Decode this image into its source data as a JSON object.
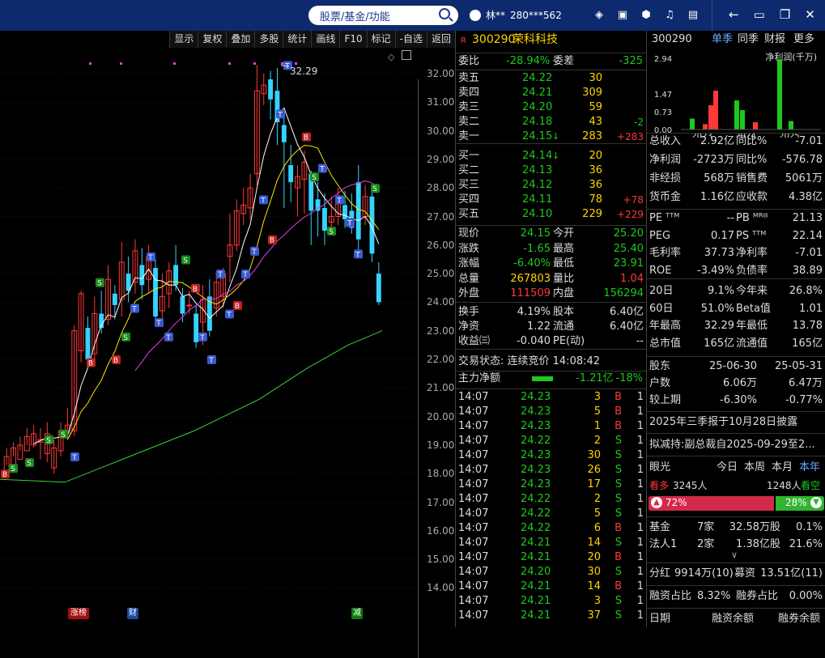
{
  "topbar": {
    "search_placeholder": "股票/基金/功能",
    "user_name": "林**",
    "user_id": "280***562",
    "window_controls": [
      "←",
      "❐",
      "✕"
    ]
  },
  "chart_menu": [
    "显示",
    "复权",
    "叠加",
    "多股",
    "统计",
    "画线",
    "F10",
    "标记",
    "-自选",
    "返回"
  ],
  "chart_price_scale": [
    "32.00",
    "31.00",
    "30.00",
    "29.00",
    "28.00",
    "27.00",
    "26.00",
    "25.00",
    "24.00",
    "23.00",
    "22.00",
    "21.00",
    "20.00",
    "19.00",
    "18.00",
    "17.00",
    "16.00",
    "15.00",
    "14.00"
  ],
  "chart_max_label": "32.29",
  "chart_bottom_tags": [
    "涨榜",
    "财",
    "减"
  ],
  "header": {
    "code": "300290",
    "name": "荣科科技",
    "badge": "R"
  },
  "weibi": {
    "label": "委比",
    "value": "-28.94%",
    "label2": "委差",
    "value2": "-325"
  },
  "asks": [
    {
      "label": "卖五",
      "price": "24.22",
      "vol": "30",
      "chg": ""
    },
    {
      "label": "卖四",
      "price": "24.21",
      "vol": "309",
      "chg": ""
    },
    {
      "label": "卖三",
      "price": "24.20",
      "vol": "59",
      "chg": ""
    },
    {
      "label": "卖二",
      "price": "24.18",
      "vol": "43",
      "chg": "-2"
    },
    {
      "label": "卖一",
      "price": "24.15",
      "vol": "283",
      "chg": "+283"
    }
  ],
  "bids": [
    {
      "label": "买一",
      "price": "24.14",
      "vol": "20",
      "chg": ""
    },
    {
      "label": "买二",
      "price": "24.13",
      "vol": "36",
      "chg": ""
    },
    {
      "label": "买三",
      "price": "24.12",
      "vol": "36",
      "chg": ""
    },
    {
      "label": "买四",
      "price": "24.11",
      "vol": "78",
      "chg": "+78"
    },
    {
      "label": "买五",
      "price": "24.10",
      "vol": "229",
      "chg": "+229"
    }
  ],
  "stats": [
    {
      "l1": "现价",
      "v1": "24.15",
      "l2": "今开",
      "v2": "25.20"
    },
    {
      "l1": "涨跌",
      "v1": "-1.65",
      "l2": "最高",
      "v2": "25.40"
    },
    {
      "l1": "涨幅",
      "v1": "-6.40%",
      "l2": "最低",
      "v2": "23.91"
    },
    {
      "l1": "总量",
      "v1": "267803",
      "l2": "量比",
      "v2": "1.04"
    },
    {
      "l1": "外盘",
      "v1": "111509",
      "l2": "内盘",
      "v2": "156294"
    }
  ],
  "stats2": [
    {
      "l1": "换手",
      "v1": "4.19%",
      "l2": "股本",
      "v2": "6.40亿"
    },
    {
      "l1": "净资",
      "v1": "1.22",
      "l2": "流通",
      "v2": "6.40亿"
    },
    {
      "l1": "收益㈢",
      "v1": "-0.040",
      "l2": "PE(动)",
      "v2": "--"
    }
  ],
  "trade_status": "交易状态: 连续竞价 14:08:42",
  "main_flow": {
    "label": "主力净额",
    "value": "-1.21亿",
    "pct": "-18%"
  },
  "ticks": [
    [
      "14:07",
      "24.23",
      "3",
      "B"
    ],
    [
      "14:07",
      "24.23",
      "5",
      "B"
    ],
    [
      "14:07",
      "24.23",
      "1",
      "B"
    ],
    [
      "14:07",
      "24.22",
      "2",
      "S"
    ],
    [
      "14:07",
      "24.23",
      "30",
      "S"
    ],
    [
      "14:07",
      "24.23",
      "26",
      "S"
    ],
    [
      "14:07",
      "24.23",
      "17",
      "S"
    ],
    [
      "14:07",
      "24.22",
      "2",
      "S"
    ],
    [
      "14:07",
      "24.22",
      "5",
      "S"
    ],
    [
      "14:07",
      "24.22",
      "6",
      "B"
    ],
    [
      "14:07",
      "24.21",
      "14",
      "S"
    ],
    [
      "14:07",
      "24.21",
      "20",
      "B"
    ],
    [
      "14:07",
      "24.20",
      "30",
      "S"
    ],
    [
      "14:07",
      "24.21",
      "14",
      "B"
    ],
    [
      "14:07",
      "24.21",
      "3",
      "S"
    ],
    [
      "14:07",
      "24.21",
      "37",
      "S"
    ]
  ],
  "info": {
    "code": "300290",
    "tabs": [
      "单季",
      "同季",
      "财报",
      "更多"
    ],
    "fin_title": "净利润(千万)",
    "fin_yticks": [
      "2.94",
      "1.47",
      "0.73",
      "0.00"
    ],
    "fin_years": [
      "2023",
      "2024",
      "2025"
    ],
    "fin_rows": [
      {
        "l1": "总收入",
        "v1": "2.92亿",
        "l2": "同比%",
        "v2": "-7.01"
      },
      {
        "l1": "净利润",
        "v1": "-2723万",
        "l2": "同比%",
        "v2": "-576.78"
      },
      {
        "l1": "非经损",
        "v1": "568万",
        "l2": "销售费",
        "v2": "5061万"
      },
      {
        "l1": "货币金",
        "v1": "1.16亿",
        "l2": "应收款",
        "v2": "4.38亿"
      }
    ],
    "val_rows": [
      {
        "l1": "PE ᵀᵀᴹ",
        "v1": "--",
        "l2": "PB ᴹᴿᴽ",
        "v2": "21.13"
      },
      {
        "l1": "PEG",
        "v1": "0.17",
        "l2": "PS ᵀᵀᴹ",
        "v2": "22.14"
      },
      {
        "l1": "毛利率",
        "v1": "37.73",
        "l2": "净利率",
        "v2": "-7.01"
      },
      {
        "l1": "ROE",
        "v1": "-3.49%",
        "l2": "负债率",
        "v2": "38.89"
      }
    ],
    "perf_rows": [
      {
        "l1": "20日",
        "v1": "9.1%",
        "l2": "今年来",
        "v2": "26.8%"
      },
      {
        "l1": "60日",
        "v1": "51.0%",
        "l2": "Beta值",
        "v2": "1.01"
      },
      {
        "l1": "年最高",
        "v1": "32.29",
        "l2": "年最低",
        "v2": "13.78"
      },
      {
        "l1": "总市值",
        "v1": "165亿",
        "l2": "流通值",
        "v2": "165亿"
      }
    ],
    "holder_rows": [
      {
        "l1": "股东",
        "v1": "25-06-30",
        "v2": "25-05-31"
      },
      {
        "l1": "户数",
        "v1": "6.06万",
        "v2": "6.47万"
      },
      {
        "l1": "较上期",
        "v1": "-6.30%",
        "v2": "-0.77%"
      }
    ],
    "notice1": "2025年三季报于10月28日披露",
    "notice2": "拟减持:副总裁自2025-09-29至2...",
    "eye_label": "眼光",
    "eye_tabs": [
      "今日",
      "本周",
      "本月",
      "本年"
    ],
    "bull_label": "看多",
    "bull_count": "3245人",
    "bear_count": "1248人",
    "bear_label": "看空",
    "bull_pct": "72%",
    "bear_pct": "28%",
    "inst_rows": [
      {
        "l1": "基金",
        "v1": "7家",
        "v2": "32.58万股",
        "v3": "0.1%"
      },
      {
        "l1": "法人1",
        "v1": "2家",
        "v2": "1.38亿股",
        "v3": "21.6%"
      }
    ],
    "div_row": {
      "l1": "分红",
      "v1": "9914万(10)",
      "l2": "募资",
      "v2": "13.51亿(11)"
    },
    "margin_row": {
      "l1": "融资占比",
      "v1": "8.32%",
      "l2": "融券占比",
      "v2": "0.00%"
    },
    "bottom_row": {
      "l1": "日期",
      "l2": "融资余额",
      "l3": "融券余额"
    }
  },
  "colors": {
    "up": "#ff3838",
    "down": "#1ec91e",
    "cyan": "#35d3ff",
    "bg": "#000000",
    "topbar": "#0d2a6e"
  }
}
